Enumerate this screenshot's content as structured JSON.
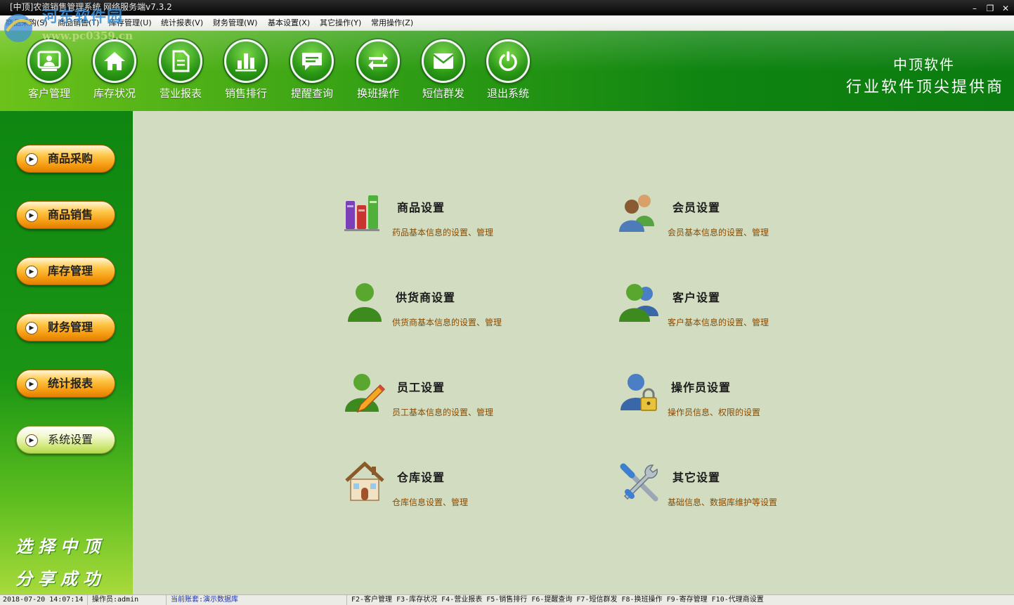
{
  "window": {
    "title": "[中顶]农资销售管理系统 网络服务端v7.3.2",
    "minimize": "–",
    "restore": "❐",
    "close": "✕"
  },
  "menu": [
    "商品采购(S)",
    "商品销售(T)",
    "库存管理(U)",
    "统计报表(V)",
    "财务管理(W)",
    "基本设置(X)",
    "其它操作(Y)",
    "常用操作(Z)"
  ],
  "watermark": {
    "name": "河东软件园",
    "url": "www.pc0359.cn"
  },
  "toolbar": {
    "buttons": [
      "客户管理",
      "库存状况",
      "营业报表",
      "销售排行",
      "提醒查询",
      "换班操作",
      "短信群发",
      "退出系统"
    ],
    "brand_line1": "中顶软件",
    "brand_line2": "行业软件顶尖提供商"
  },
  "sidebar": {
    "buttons": [
      "商品采购",
      "商品销售",
      "库存管理",
      "财务管理",
      "统计报表",
      "系统设置"
    ],
    "active": "系统设置",
    "slogan_line1": "选择中顶",
    "slogan_line2": "分享成功"
  },
  "settings": [
    {
      "title": "商品设置",
      "desc": "药品基本信息的设置、管理"
    },
    {
      "title": "会员设置",
      "desc": "会员基本信息的设置、管理"
    },
    {
      "title": "供货商设置",
      "desc": "供货商基本信息的设置、管理"
    },
    {
      "title": "客户设置",
      "desc": "客户基本信息的设置、管理"
    },
    {
      "title": "员工设置",
      "desc": "员工基本信息的设置、管理"
    },
    {
      "title": "操作员设置",
      "desc": "操作员信息、权限的设置"
    },
    {
      "title": "仓库设置",
      "desc": "仓库信息设置、管理"
    },
    {
      "title": "其它设置",
      "desc": "基础信息、数据库维护等设置"
    }
  ],
  "status": {
    "datetime": "2018-07-20 14:07:14",
    "operator": "操作员:admin",
    "account": "当前账套:演示数据库",
    "shortcuts": "F2-客户管理 F3-库存状况 F4-营业报表 F5-销售排行 F6-提醒查询 F7-短信群发 F8-换班操作 F9-寄存管理 F10-代理商设置"
  }
}
